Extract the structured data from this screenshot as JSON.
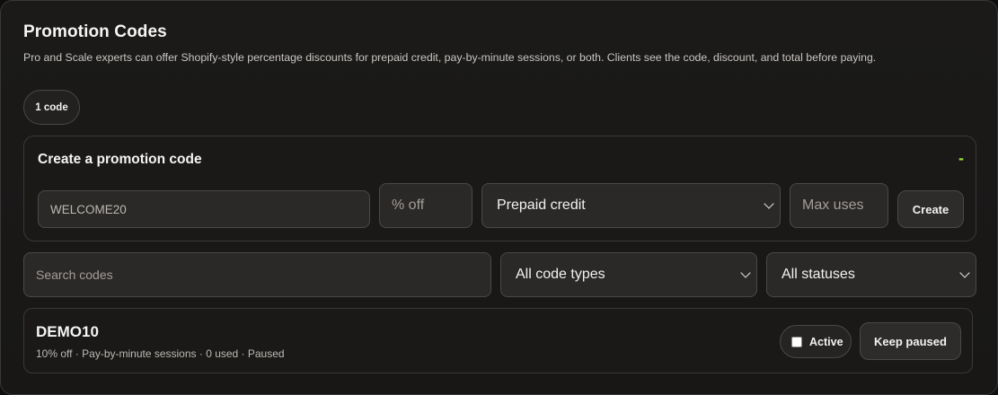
{
  "section": {
    "title": "Promotion Codes",
    "subtitle": "Pro and Scale experts can offer Shopify-style percentage discounts for prepaid credit, pay-by-minute sessions, or both. Clients see the code, discount, and total before paying."
  },
  "code_count": "1 code",
  "create_form": {
    "title": "Create a promotion code",
    "collapse_label": "-",
    "code_value": "WELCOME20",
    "percent_placeholder": "% off",
    "type_selected": "Prepaid credit",
    "max_uses_placeholder": "Max uses",
    "create_label": "Create"
  },
  "filters": {
    "search_placeholder": "Search codes",
    "code_type_selected": "All code types",
    "status_selected": "All statuses"
  },
  "codes": [
    {
      "name": "DEMO10",
      "meta": "10% off · Pay-by-minute sessions · 0 used · Paused",
      "active_label": "Active",
      "active_checked": false,
      "action_label": "Keep paused"
    }
  ],
  "colors": {
    "accent": "#9be23a",
    "background": "#1b1a19",
    "border": "#3a3836"
  }
}
